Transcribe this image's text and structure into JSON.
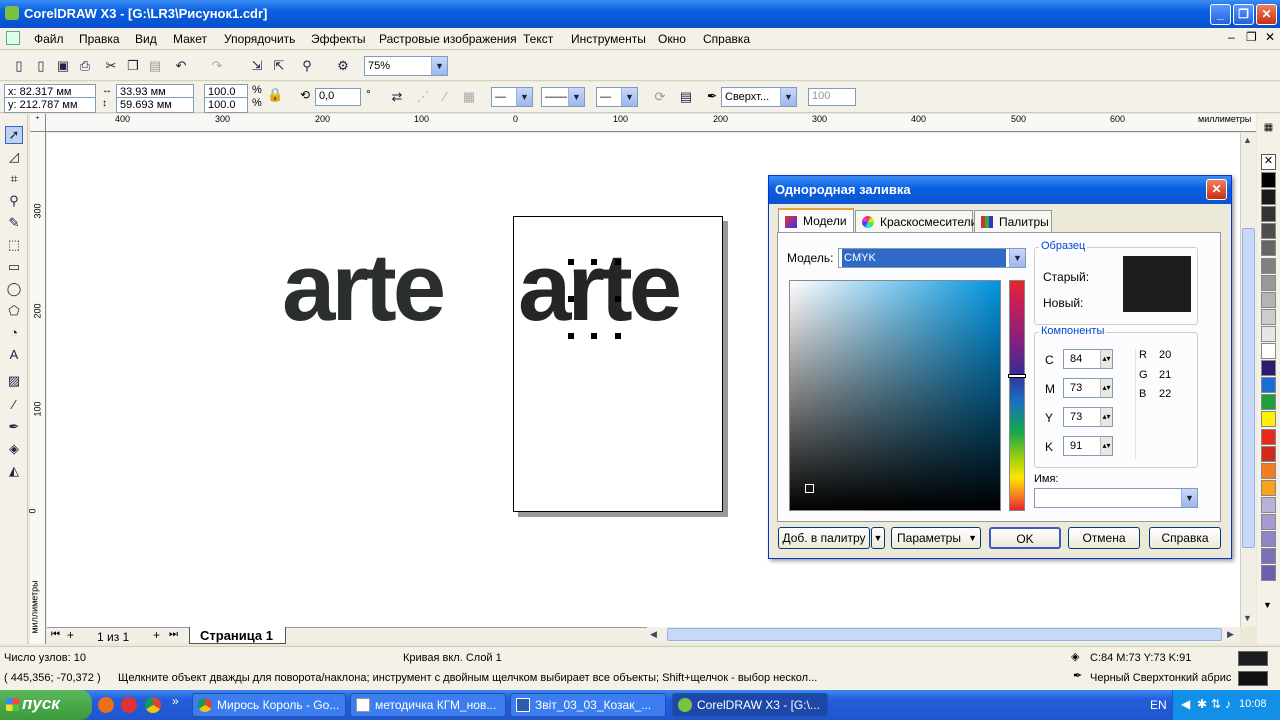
{
  "window": {
    "title": "CorelDRAW X3 - [G:\\LR3\\Рисунок1.cdr]"
  },
  "menu": [
    "Файл",
    "Правка",
    "Вид",
    "Макет",
    "Упорядочить",
    "Эффекты",
    "Растровые изображения",
    "Текст",
    "Инструменты",
    "Окно",
    "Справка"
  ],
  "toolbar": {
    "zoom": "75%"
  },
  "propbar": {
    "x": "x: 82.317 мм",
    "y": "y: 212.787 мм",
    "w": "33.93 мм",
    "h": "59.693 мм",
    "scale_x": "100.0",
    "scale_y": "100.0",
    "pct": "%",
    "angle": "0,0",
    "deg": "°",
    "outline_combo": "Сверхт...",
    "spin_val": "100"
  },
  "ruler": {
    "h_labels": [
      "400",
      "300",
      "200",
      "100",
      "0",
      "100",
      "200",
      "300",
      "400",
      "500",
      "600"
    ],
    "v_labels": [
      "300",
      "200",
      "100",
      "0"
    ],
    "unit": "миллиметры"
  },
  "canvas": {
    "text1": "arte",
    "text2": "arte"
  },
  "pagenav": {
    "counter": "1 из 1",
    "tab": "Страница 1"
  },
  "dialog": {
    "title": "Однородная заливка",
    "tabs": [
      "Модели",
      "Краскосмесители",
      "Палитры"
    ],
    "model_label": "Модель:",
    "model_value": "CMYK",
    "sample_group": "Образец",
    "old_label": "Старый:",
    "new_label": "Новый:",
    "components_group": "Компоненты",
    "cmyk": [
      {
        "k": "C",
        "v": "84"
      },
      {
        "k": "M",
        "v": "73"
      },
      {
        "k": "Y",
        "v": "73"
      },
      {
        "k": "K",
        "v": "91"
      }
    ],
    "rgb": [
      {
        "k": "R",
        "v": "20"
      },
      {
        "k": "G",
        "v": "21"
      },
      {
        "k": "B",
        "v": "22"
      }
    ],
    "name_label": "Имя:",
    "btn_add": "Доб. в палитру",
    "btn_params": "Параметры",
    "btn_ok": "OK",
    "btn_cancel": "Отмена",
    "btn_help": "Справка",
    "sample_color": "#1c1d1e"
  },
  "status": {
    "nodes": "Число узлов: 10",
    "curve": "Кривая вкл. Слой 1",
    "coords": "( 445,356; -70,372 )",
    "hint": "Щелкните объект дважды для поворота/наклона; инструмент с двойным щелчком выбирает все объекты; Shift+щелчок - выбор нескол...",
    "fill_info": "C:84 M:73 Y:73 K:91",
    "outline_info": "Черный  Сверхтонкий абрис"
  },
  "taskbar": {
    "start": "пуск",
    "tasks": [
      "Мирось Король - Go...",
      "методичка КГМ_нов...",
      "Звіт_03_03_Козак_...",
      "CorelDRAW X3 - [G:\\..."
    ],
    "lang": "EN",
    "time": "10:08"
  },
  "palette_colors": [
    "#000000",
    "#1a1a1a",
    "#333333",
    "#4d4d4d",
    "#666666",
    "#808080",
    "#999999",
    "#b3b3b3",
    "#cccccc",
    "#e6e6e6",
    "#ffffff",
    "#2e1a6e",
    "#1a6fd6",
    "#1f9e3c",
    "#fff200",
    "#e8281c",
    "#d12a1a",
    "#f47c20",
    "#f7a21b",
    "#b9b2d8",
    "#a59bd0",
    "#8f85c6",
    "#7a6fb8",
    "#6a5fae"
  ]
}
